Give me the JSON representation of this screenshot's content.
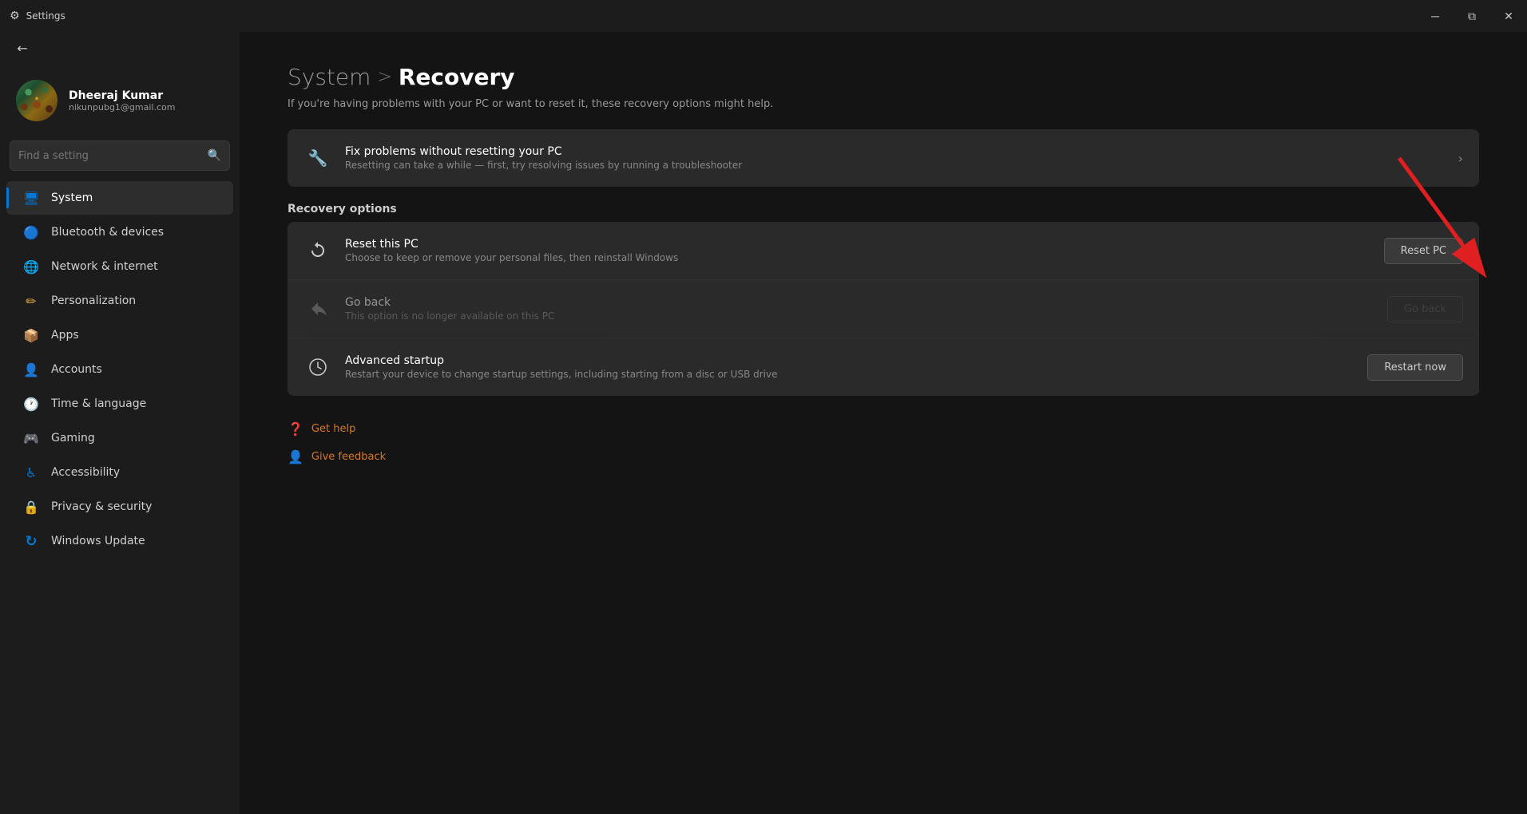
{
  "titlebar": {
    "title": "Settings",
    "minimize_label": "─",
    "maximize_label": "⧉",
    "close_label": "✕"
  },
  "sidebar": {
    "back_label": "←",
    "search_placeholder": "Find a setting",
    "user": {
      "name": "Dheeraj Kumar",
      "email": "nikunpubg1@gmail.com"
    },
    "nav_items": [
      {
        "id": "system",
        "label": "System",
        "icon": "🖥",
        "active": true
      },
      {
        "id": "bluetooth",
        "label": "Bluetooth & devices",
        "icon": "🔵",
        "active": false
      },
      {
        "id": "network",
        "label": "Network & internet",
        "icon": "🌐",
        "active": false
      },
      {
        "id": "personalization",
        "label": "Personalization",
        "icon": "✏",
        "active": false
      },
      {
        "id": "apps",
        "label": "Apps",
        "icon": "📦",
        "active": false
      },
      {
        "id": "accounts",
        "label": "Accounts",
        "icon": "👤",
        "active": false
      },
      {
        "id": "time",
        "label": "Time & language",
        "icon": "🕐",
        "active": false
      },
      {
        "id": "gaming",
        "label": "Gaming",
        "icon": "🎮",
        "active": false
      },
      {
        "id": "accessibility",
        "label": "Accessibility",
        "icon": "♿",
        "active": false
      },
      {
        "id": "privacy",
        "label": "Privacy & security",
        "icon": "🔒",
        "active": false
      },
      {
        "id": "winupdate",
        "label": "Windows Update",
        "icon": "⟳",
        "active": false
      }
    ]
  },
  "main": {
    "breadcrumb_parent": "System",
    "breadcrumb_sep": ">",
    "breadcrumb_current": "Recovery",
    "subtitle": "If you're having problems with your PC or want to reset it, these recovery options might help.",
    "fix_section": {
      "icon": "🔧",
      "title": "Fix problems without resetting your PC",
      "desc": "Resetting can take a while — first, try resolving issues by running a troubleshooter"
    },
    "recovery_section_label": "Recovery options",
    "recovery_options": [
      {
        "id": "reset",
        "icon": "🔄",
        "title": "Reset this PC",
        "desc": "Choose to keep or remove your personal files, then reinstall Windows",
        "button_label": "Reset PC",
        "disabled": false
      },
      {
        "id": "goback",
        "icon": "↩",
        "title": "Go back",
        "desc": "This option is no longer available on this PC",
        "button_label": "Go back",
        "disabled": true
      },
      {
        "id": "advanced",
        "icon": "⚡",
        "title": "Advanced startup",
        "desc": "Restart your device to change startup settings, including starting from a disc or USB drive",
        "button_label": "Restart now",
        "disabled": false
      }
    ],
    "links": [
      {
        "id": "get-help",
        "label": "Get help",
        "icon": "❓"
      },
      {
        "id": "give-feedback",
        "label": "Give feedback",
        "icon": "👤"
      }
    ]
  }
}
